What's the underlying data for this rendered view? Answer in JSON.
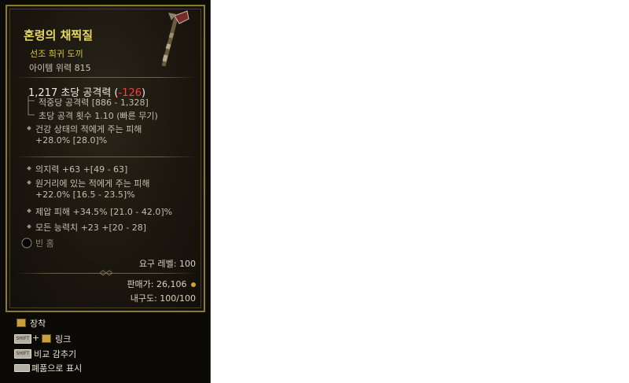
{
  "item": {
    "name": "혼령의 채찍질",
    "rarity_type": "선조 희귀 도끼",
    "item_power": "아이템 위력 815",
    "dps_value": "1,217 초당 공격력",
    "dps_change_open": "(",
    "dps_change": "-126",
    "dps_change_close": ")",
    "damage_per_hit": "적중당 공격력 [886 - 1,328]",
    "attacks_per_second": "초당 공격 횟수 1.10 (빠른 무기)",
    "implicit_line1": "건강 상태의 적에게 주는 피해",
    "implicit_line2": "+28.0% [28.0]%",
    "affixes": [
      {
        "line1": "의지력 +63 +[49 - 63]",
        "line2": ""
      },
      {
        "line1": "원거리에 있는 적에게 주는 피해",
        "line2": "+22.0% [16.5 - 23.5]%"
      },
      {
        "line1": "제압 피해 +34.5% [21.0 - 42.0]%",
        "line2": ""
      },
      {
        "line1": "모든 능력치 +23 +[20 - 28]",
        "line2": ""
      }
    ],
    "empty_socket": "빈 홈",
    "required_level": "요구 레벨: 100",
    "sell_price": "판매가: 26,106",
    "durability": "내구도: 100/100"
  },
  "controls": {
    "equip": "장착",
    "shift_key": "SHIFT",
    "plus": "+",
    "link": "링크",
    "compare_hide": "비교 감추기",
    "hide_key": "SHIFT",
    "show_as_text": "폐품으로 표시"
  },
  "colors": {
    "title": "#e6d860",
    "negative": "#ff3b3b",
    "border": "#8b7a2e"
  },
  "icons": [
    "axe-icon",
    "gold-coin-icon",
    "book-icon",
    "keyboard-key-icon",
    "empty-socket-icon",
    "spacebar-key-icon"
  ]
}
